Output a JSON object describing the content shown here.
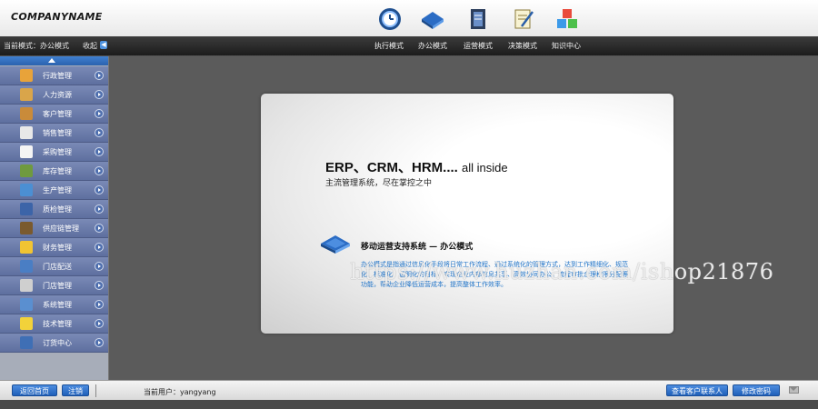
{
  "header": {
    "company_name": "COMPANYNAME",
    "mode_icons": [
      "clock-icon",
      "book-icon",
      "document-icon",
      "notepad-icon",
      "cubes-icon"
    ],
    "current_mode_label": "当前模式：办公模式",
    "collapse_label": "收起",
    "mode_tabs": [
      {
        "label": "执行模式"
      },
      {
        "label": "办公模式"
      },
      {
        "label": "运营模式"
      },
      {
        "label": "决策模式"
      },
      {
        "label": "知识中心"
      }
    ]
  },
  "sidebar": {
    "items": [
      {
        "label": "行政管理",
        "icon": "admin-icon",
        "color": "#e8a33a"
      },
      {
        "label": "人力资源",
        "icon": "people-icon",
        "color": "#d9a54a"
      },
      {
        "label": "客户管理",
        "icon": "customer-icon",
        "color": "#c98b3a"
      },
      {
        "label": "销售管理",
        "icon": "sales-icon",
        "color": "#e8e8e8"
      },
      {
        "label": "采购管理",
        "icon": "purchase-icon",
        "color": "#f4f4f4"
      },
      {
        "label": "库存管理",
        "icon": "inventory-icon",
        "color": "#6f9a3f"
      },
      {
        "label": "生产管理",
        "icon": "production-icon",
        "color": "#4b8fd3"
      },
      {
        "label": "质检管理",
        "icon": "quality-icon",
        "color": "#3c64a8"
      },
      {
        "label": "供应链管理",
        "icon": "supply-chain-icon",
        "color": "#7a5a2e"
      },
      {
        "label": "财务管理",
        "icon": "finance-icon",
        "color": "#f1c432"
      },
      {
        "label": "门店配送",
        "icon": "delivery-icon",
        "color": "#4a7ec4"
      },
      {
        "label": "门店管理",
        "icon": "store-icon",
        "color": "#cfcfcf"
      },
      {
        "label": "系统管理",
        "icon": "system-icon",
        "color": "#5a8fd0"
      },
      {
        "label": "技术管理",
        "icon": "tech-icon",
        "color": "#f2d23a"
      },
      {
        "label": "订货中心",
        "icon": "order-icon",
        "color": "#3f6fb5"
      }
    ]
  },
  "main": {
    "headline": "ERP、CRM、HRM....",
    "headline_suffix": "all inside",
    "subtitle": "主流管理系统，尽在掌控之中",
    "section_heading": "移动运营支持系统 — 办公模式",
    "section_desc": "办公模式是指通过信息化手段将日常工作流程、通过系统化的管理方式，达到工作精细化、规范化、标准化、透明化的目标，实现企业内部信息共享、高效协同办公。流程审批合理权限分配等功能，帮助企业降低运营成本，提高整体工作效率。",
    "watermark": "https://www.huzhan.com/ishop21876"
  },
  "footer": {
    "home_button": "返回首页",
    "logout_button": "注销",
    "current_user": "当前用户：yangyang",
    "contacts_button": "查看客户联系人",
    "password_button": "修改密码"
  },
  "colors": {
    "accent": "#2b62ae",
    "sidebar_item": "#6b7cab",
    "desc_text": "#1f73c8"
  }
}
